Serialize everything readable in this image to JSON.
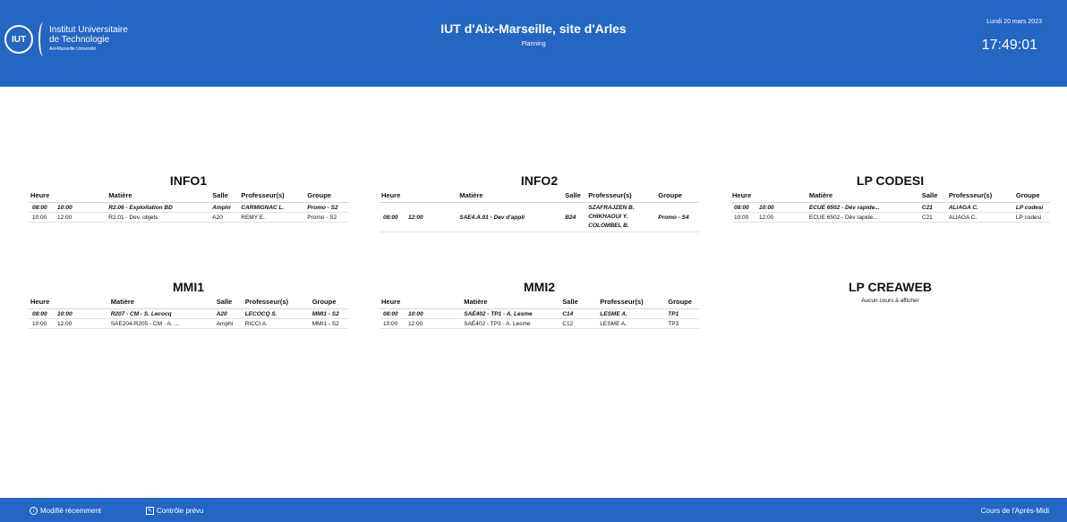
{
  "header": {
    "logo_line1": "Institut Universitaire",
    "logo_line2": "de Technologie",
    "logo_line3": "Aix•Marseille Université",
    "logo_mark": "IUT",
    "title": "IUT d'Aix-Marseille, site d'Arles",
    "subtitle": "Planning",
    "date": "Lundi 20 mars 2023",
    "time": "17:49:01"
  },
  "columns": {
    "heure": "Heure",
    "matiere": "Matière",
    "salle": "Salle",
    "prof": "Professeur(s)",
    "groupe": "Groupe"
  },
  "panels": {
    "info1": {
      "title": "INFO1",
      "rows": [
        {
          "start": "08:00",
          "end": "10:00",
          "matiere": "R2.06 - Exploitation BD",
          "salle": "Amphi",
          "prof": "CARMIGNAC L.",
          "groupe": "Promo - S2"
        },
        {
          "start": "10:00",
          "end": "12:00",
          "matiere": "R2.01 - Dev. objets",
          "salle": "A20",
          "prof": "REMY E.",
          "groupe": "Promo - S2"
        }
      ]
    },
    "info2": {
      "title": "INFO2",
      "rows": [
        {
          "start": "08:00",
          "end": "12:00",
          "matiere": "SAE4.A.01 - Dev d'appli",
          "salle": "B24",
          "prof1": "SZAFRAJZEN B.",
          "prof2": "CHIKHAOUI Y.",
          "prof3": "COLOMBEL B.",
          "groupe": "Promo - S4"
        }
      ]
    },
    "lpcodesi": {
      "title": "LP CODESI",
      "rows": [
        {
          "start": "08:00",
          "end": "10:00",
          "matiere": "ECUE 6502 - Dév rapide...",
          "salle": "C21",
          "prof": "ALIAGA C.",
          "groupe": "LP codesi"
        },
        {
          "start": "10:00",
          "end": "12:00",
          "matiere": "ECUE 6502 - Dév rapide...",
          "salle": "C21",
          "prof": "ALIAGA C.",
          "groupe": "LP codesi"
        }
      ]
    },
    "mmi1": {
      "title": "MMI1",
      "rows": [
        {
          "start": "08:00",
          "end": "10:00",
          "matiere": "R207 - CM - S. Lecocq",
          "salle": "A20",
          "prof": "LECOCQ S.",
          "groupe": "MMI1 - S2"
        },
        {
          "start": "10:00",
          "end": "12:00",
          "matiere": "SAE204-R205 - CM - A. ...",
          "salle": "Amphi",
          "prof": "RICCI A.",
          "groupe": "MMI1 - S2"
        }
      ]
    },
    "mmi2": {
      "title": "MMI2",
      "rows": [
        {
          "start": "08:00",
          "end": "10:00",
          "matiere": "SAÉ402 - TP1 - A. Lesme",
          "salle": "C14",
          "prof": "LESME A.",
          "groupe": "TP1"
        },
        {
          "start": "10:00",
          "end": "12:00",
          "matiere": "SAÉ402 - TP3 - A. Lesme",
          "salle": "C12",
          "prof": "LESME A.",
          "groupe": "TP3"
        }
      ]
    },
    "lpcreaweb": {
      "title": "LP CREAWEB",
      "empty": "Aucun cours à afficher"
    }
  },
  "footer": {
    "modified": "Modifié récemment",
    "control": "Contrôle prévu",
    "period": "Cours de l'Après-Midi"
  },
  "colors": {
    "brand_blue": "#2366c4"
  },
  "icons": {
    "info": "info-icon",
    "control": "edit-icon"
  }
}
